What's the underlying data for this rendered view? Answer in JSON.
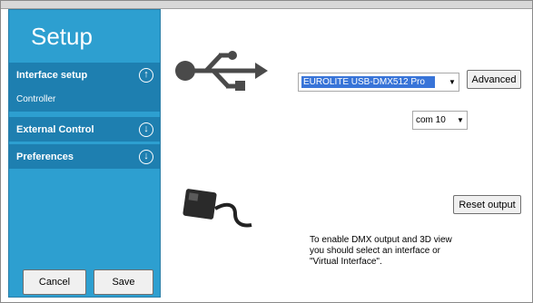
{
  "sidebar": {
    "title": "Setup",
    "sections": [
      {
        "label": "Interface setup",
        "sub": "Controller",
        "icon": "circle-up-arrow-icon"
      },
      {
        "label": "External Control",
        "icon": "circle-down-arrow-icon"
      },
      {
        "label": "Preferences",
        "icon": "circle-down-arrow-icon"
      }
    ],
    "cancel_label": "Cancel",
    "save_label": "Save"
  },
  "main": {
    "interface_select": "EUROLITE USB-DMX512 Pro",
    "advanced_label": "Advanced",
    "com_select": "com 10",
    "reset_label": "Reset output",
    "info_lines": [
      "To enable DMX output and 3D view",
      "you should select an interface or",
      "\"Virtual Interface\"."
    ]
  },
  "colors": {
    "sidebar": "#2d9fd0",
    "section": "#1e7fb0",
    "select_highlight": "#3874d8"
  }
}
